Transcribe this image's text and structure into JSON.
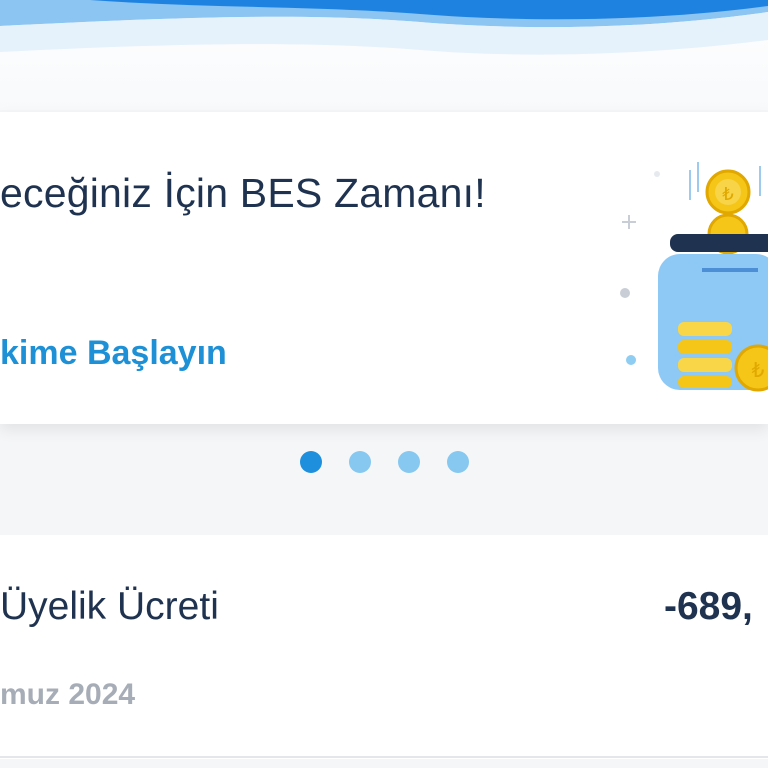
{
  "banner": {
    "title": "eceğiniz İçin BES Zamanı!",
    "cta": "kime Başlayın"
  },
  "carousel": {
    "total_pages": 4,
    "active_page": 1
  },
  "transaction": {
    "title": "Üyelik Ücreti",
    "amount": "-689,",
    "date": "muz 2024"
  },
  "colors": {
    "brand_blue": "#1e90d6",
    "text_dark": "#1f3350",
    "dot_active": "#1e8fdc",
    "dot_inactive": "#86c8ef"
  }
}
